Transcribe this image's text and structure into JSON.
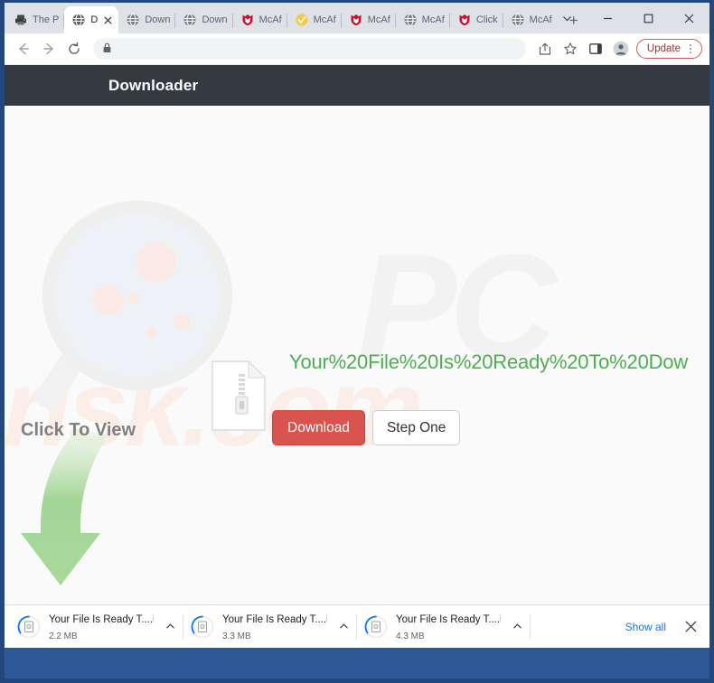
{
  "window": {
    "controls": {
      "tab_search_label": "Search tabs",
      "minimize_label": "Minimize",
      "maximize_label": "Maximize",
      "close_label": "Close"
    }
  },
  "tabstrip": {
    "new_tab_label": "+",
    "tabs": [
      {
        "label": "The P",
        "favicon": "printer-icon",
        "active": false
      },
      {
        "label": "D",
        "favicon": "globe-icon",
        "active": true
      },
      {
        "label": "Down",
        "favicon": "globe-icon",
        "active": false
      },
      {
        "label": "Down",
        "favicon": "globe-icon",
        "active": false
      },
      {
        "label": "McAf",
        "favicon": "mcafee-shield-icon",
        "active": false
      },
      {
        "label": "McAf",
        "favicon": "check-badge-icon",
        "active": false
      },
      {
        "label": "McAf",
        "favicon": "mcafee-shield-icon",
        "active": false
      },
      {
        "label": "McAf",
        "favicon": "globe-icon",
        "active": false
      },
      {
        "label": "Click",
        "favicon": "mcafee-shield-icon",
        "active": false
      },
      {
        "label": "McAf",
        "favicon": "globe-icon",
        "active": false
      }
    ]
  },
  "toolbar": {
    "back_label": "Back",
    "forward_label": "Forward",
    "reload_label": "Reload",
    "address": {
      "value": "",
      "placeholder": "",
      "lock_icon": "lock-icon"
    },
    "share_label": "Share",
    "bookmark_label": "Bookmark this tab",
    "sidepanel_label": "Side panel",
    "profile_label": "Profile",
    "update": {
      "label": "Update",
      "menu_glyph": "⋮",
      "border_color": "#c75d63",
      "text_color": "#b3272e"
    }
  },
  "page": {
    "header": {
      "brand": "Downloader",
      "background_color": "#343a40",
      "text_color": "#ffffff"
    },
    "watermark": {
      "top_text": "PC",
      "bottom_text": "risk.com"
    },
    "filename_text": "Your%20File%20Is%20Ready%20To%20Dow",
    "filename_color": "#4caf50",
    "click_to_view": "Click To View",
    "buttons": {
      "download": {
        "label": "Download",
        "color": "#d9534f",
        "text_color": "#ffffff"
      },
      "step_one": {
        "label": "Step One",
        "color": "#ffffff",
        "text_color": "#333333"
      }
    },
    "illustration": {
      "magnifier": "magnifying-glass-icon",
      "file": "zip-file-icon",
      "arrow": "curved-down-arrow-icon"
    },
    "scrollbar": {
      "thumb_percent": 87
    }
  },
  "downloads_bar": {
    "items": [
      {
        "name": "Your File Is Ready T....iso",
        "size": "2.2 MB",
        "caret": "chevron-up-icon"
      },
      {
        "name": "Your File Is Ready T....iso",
        "size": "3.3 MB",
        "caret": "chevron-up-icon"
      },
      {
        "name": "Your File Is Ready T....iso",
        "size": "4.3 MB",
        "caret": "chevron-up-icon"
      }
    ],
    "show_all_label": "Show all",
    "close_label": "Close downloads bar",
    "link_color": "#1a73e8"
  }
}
